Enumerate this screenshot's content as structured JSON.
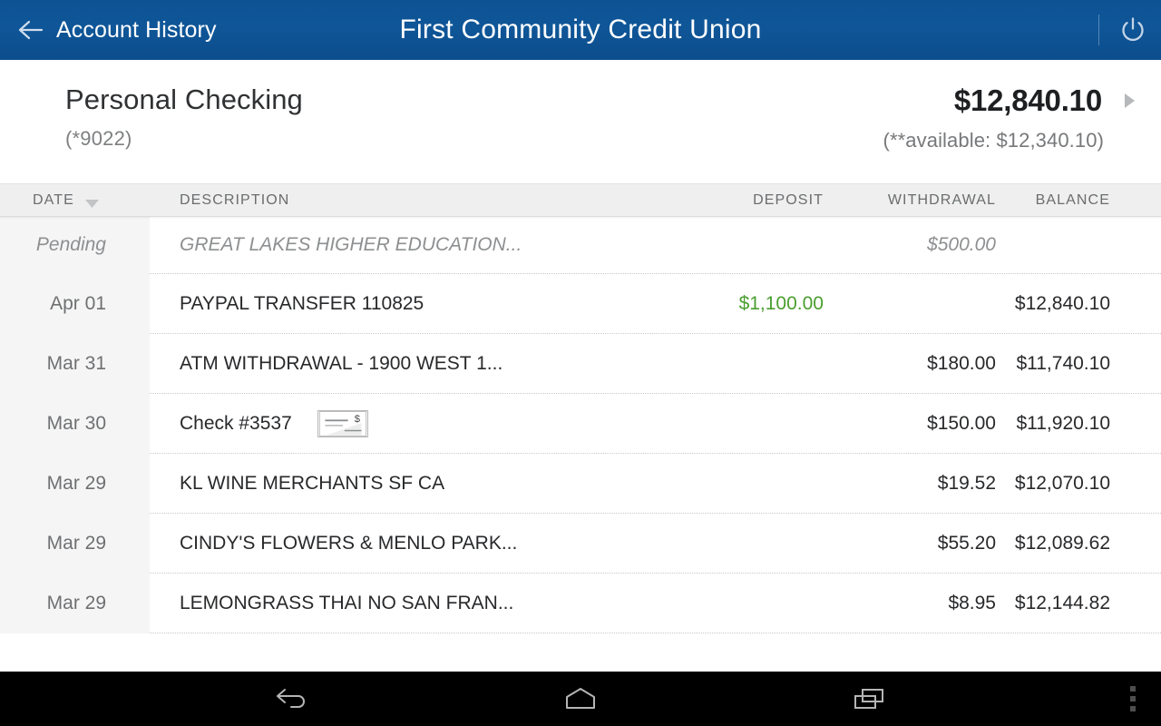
{
  "appbar": {
    "back_label": "Account History",
    "title": "First Community Credit Union",
    "back_icon": "back-arrow-icon",
    "power_icon": "power-icon"
  },
  "account": {
    "name": "Personal Checking",
    "number_masked": "(*9022)",
    "balance": "$12,840.10",
    "available": "(**available: $12,340.10)",
    "detail_chevron_icon": "chevron-right-icon"
  },
  "table": {
    "columns": {
      "date": "DATE",
      "description": "DESCRIPTION",
      "deposit": "DEPOSIT",
      "withdrawal": "WITHDRAWAL",
      "balance": "BALANCE"
    },
    "sort_column": "DATE",
    "sort_icon": "sort-descending-caret-icon",
    "rows": [
      {
        "date": "Pending",
        "description": "GREAT LAKES HIGHER EDUCATION...",
        "deposit": "",
        "withdrawal": "$500.00",
        "balance": "",
        "pending": true,
        "check_image": false
      },
      {
        "date": "Apr 01",
        "description": "PAYPAL TRANSFER 110825",
        "deposit": "$1,100.00",
        "withdrawal": "",
        "balance": "$12,840.10",
        "pending": false,
        "check_image": false
      },
      {
        "date": "Mar 31",
        "description": "ATM WITHDRAWAL - 1900 WEST 1...",
        "deposit": "",
        "withdrawal": "$180.00",
        "balance": "$11,740.10",
        "pending": false,
        "check_image": false
      },
      {
        "date": "Mar 30",
        "description": "Check #3537",
        "deposit": "",
        "withdrawal": "$150.00",
        "balance": "$11,920.10",
        "pending": false,
        "check_image": true
      },
      {
        "date": "Mar 29",
        "description": "KL WINE MERCHANTS SF CA",
        "deposit": "",
        "withdrawal": "$19.52",
        "balance": "$12,070.10",
        "pending": false,
        "check_image": false
      },
      {
        "date": "Mar 29",
        "description": "CINDY'S FLOWERS & MENLO PARK...",
        "deposit": "",
        "withdrawal": "$55.20",
        "balance": "$12,089.62",
        "pending": false,
        "check_image": false
      },
      {
        "date": "Mar 29",
        "description": "LEMONGRASS THAI NO SAN FRAN...",
        "deposit": "",
        "withdrawal": "$8.95",
        "balance": "$12,144.82",
        "pending": false,
        "check_image": false
      }
    ]
  },
  "navbar": {
    "back_icon": "android-back-icon",
    "home_icon": "android-home-icon",
    "recents_icon": "android-recents-icon",
    "overflow_icon": "overflow-menu-icon"
  },
  "colors": {
    "appbar_blue": "#0f5698",
    "deposit_green": "#4a9e2f",
    "date_column_bg": "#f5f5f5",
    "table_header_bg": "#efefef"
  }
}
